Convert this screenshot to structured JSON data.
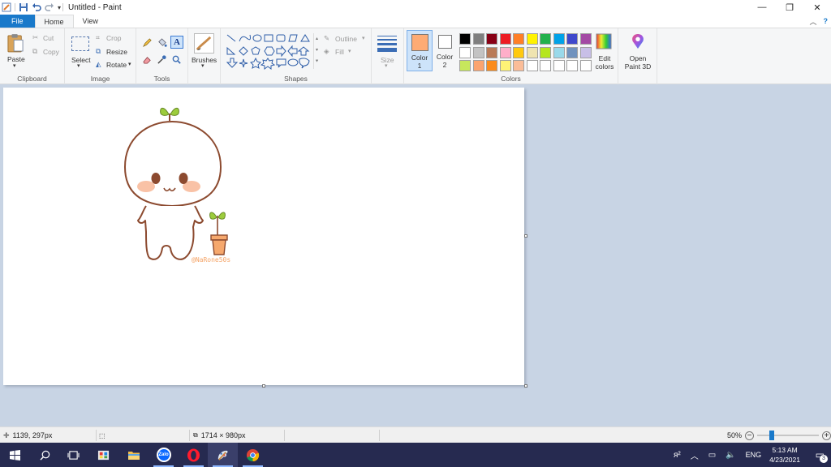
{
  "window": {
    "title": "Untitled - Paint",
    "controls": {
      "minimize": "—",
      "restore": "❐",
      "close": "✕"
    }
  },
  "tabs": [
    {
      "label": "File"
    },
    {
      "label": "Home"
    },
    {
      "label": "View"
    }
  ],
  "ribbon": {
    "clipboard": {
      "paste": "Paste",
      "cut": "Cut",
      "copy": "Copy",
      "group": "Clipboard"
    },
    "image": {
      "select": "Select",
      "crop": "Crop",
      "resize": "Resize",
      "rotate": "Rotate",
      "group": "Image"
    },
    "tools": {
      "group": "Tools"
    },
    "brushes": {
      "label": "Brushes"
    },
    "shapes": {
      "outline": "Outline",
      "fill": "Fill",
      "group": "Shapes"
    },
    "size": {
      "label": "Size"
    },
    "colors": {
      "color1_label": "Color\n1",
      "color1": "#fdab74",
      "color2_label": "Color\n2",
      "color2": "#ffffff",
      "palette_row1": [
        "#000000",
        "#7f7f7f",
        "#880015",
        "#ed1c24",
        "#ff7f27",
        "#fff200",
        "#22b14c",
        "#00a2e8",
        "#3f48cc",
        "#a349a4"
      ],
      "palette_row2": [
        "#ffffff",
        "#c3c3c3",
        "#b97a57",
        "#ffaec9",
        "#ffc90e",
        "#efe4b0",
        "#b5e61d",
        "#99d9ea",
        "#7092be",
        "#c8bfe7"
      ],
      "palette_row3": [
        "#c7e75c",
        "#fba46f",
        "#fb8c1c",
        "#fef276",
        "#fbbd98",
        "#ffffff",
        "#ffffff",
        "#ffffff",
        "#ffffff",
        "#ffffff"
      ],
      "edit": "Edit\ncolors",
      "group": "Colors"
    },
    "paint3d": {
      "label": "Open\nPaint 3D"
    }
  },
  "canvas": {
    "watermark": "@NaRone50s",
    "figure_color": "#8c4a2f",
    "blush_color": "#f9c2a6",
    "sprout_color": "#9ccc3c",
    "pot_color": "#f6a86d"
  },
  "status": {
    "cursor": "1139, 297px",
    "size": "1714 × 980px",
    "zoom": "50%",
    "zoom_level": 0.5
  },
  "taskbar": {
    "language": "ENG",
    "time": "5:13 AM",
    "date": "4/23/2021",
    "notification_count": "3",
    "apps": [
      "start",
      "search",
      "task-view",
      "paint-app",
      "file-explorer",
      "zalo",
      "opera",
      "paint",
      "chrome"
    ]
  }
}
